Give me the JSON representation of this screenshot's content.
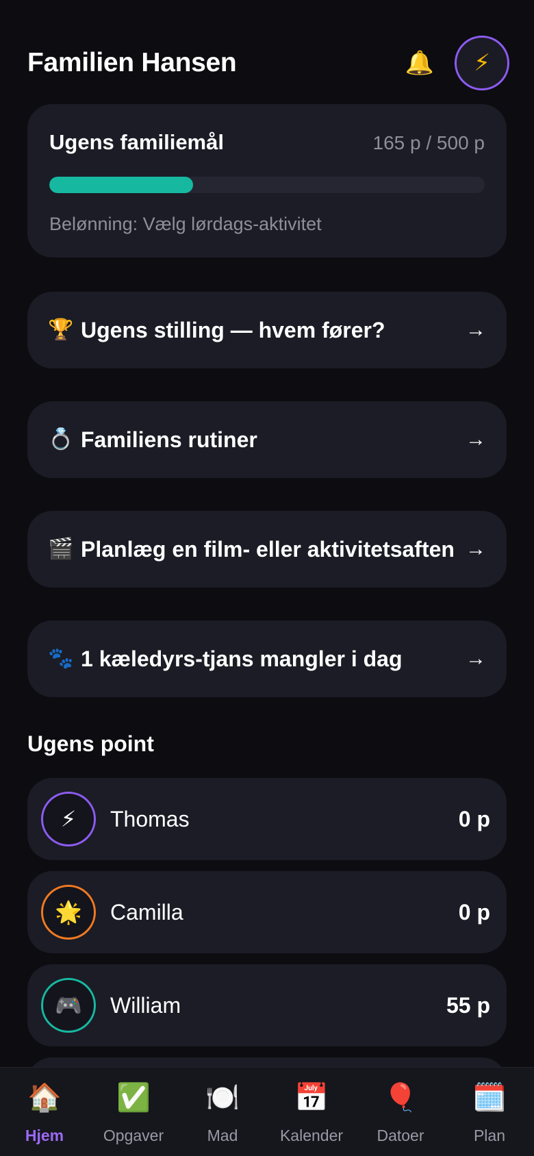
{
  "header": {
    "title": "Familien Hansen",
    "bell_icon": "🔔",
    "avatar_icon": "⚡"
  },
  "goal": {
    "title": "Ugens familiemål",
    "points_text": "165 p / 500 p",
    "progress": 0.33,
    "reward": "Belønning: Vælg lørdags-aktivitet",
    "accent": "#17b8a0"
  },
  "actions": [
    {
      "emoji": "🏆",
      "label": "Ugens stilling — hvem fører?",
      "arrow": "→"
    },
    {
      "emoji": "💍",
      "label": "Familiens rutiner",
      "arrow": "→"
    },
    {
      "emoji": "🎬",
      "label": "Planlæg en film- eller aktivitetsaften",
      "arrow": "→"
    },
    {
      "emoji": "🐾",
      "label": "1 kæledyrs-tjans mangler i dag",
      "arrow": "→"
    }
  ],
  "points_section": {
    "title": "Ugens point",
    "members": [
      {
        "name": "Thomas",
        "points": "0 p",
        "icon": "⚡",
        "ring_color": "#8c5cf0"
      },
      {
        "name": "Camilla",
        "points": "0 p",
        "icon": "🌟",
        "ring_color": "#f07a22"
      },
      {
        "name": "William",
        "points": "55 p",
        "icon": "🎮",
        "ring_color": "#17b8a0"
      }
    ]
  },
  "nav": [
    {
      "label": "Hjem",
      "icon": "🏠",
      "active": true
    },
    {
      "label": "Opgaver",
      "icon": "✅",
      "active": false
    },
    {
      "label": "Mad",
      "icon": "🍽️",
      "active": false
    },
    {
      "label": "Kalender",
      "icon": "📅",
      "active": false
    },
    {
      "label": "Datoer",
      "icon": "🎈",
      "active": false
    },
    {
      "label": "Plan",
      "icon": "🗓️",
      "active": false
    }
  ],
  "colors": {
    "background": "#0c0c11",
    "card": "#1b1c25",
    "active_nav": "#9b6af5"
  }
}
